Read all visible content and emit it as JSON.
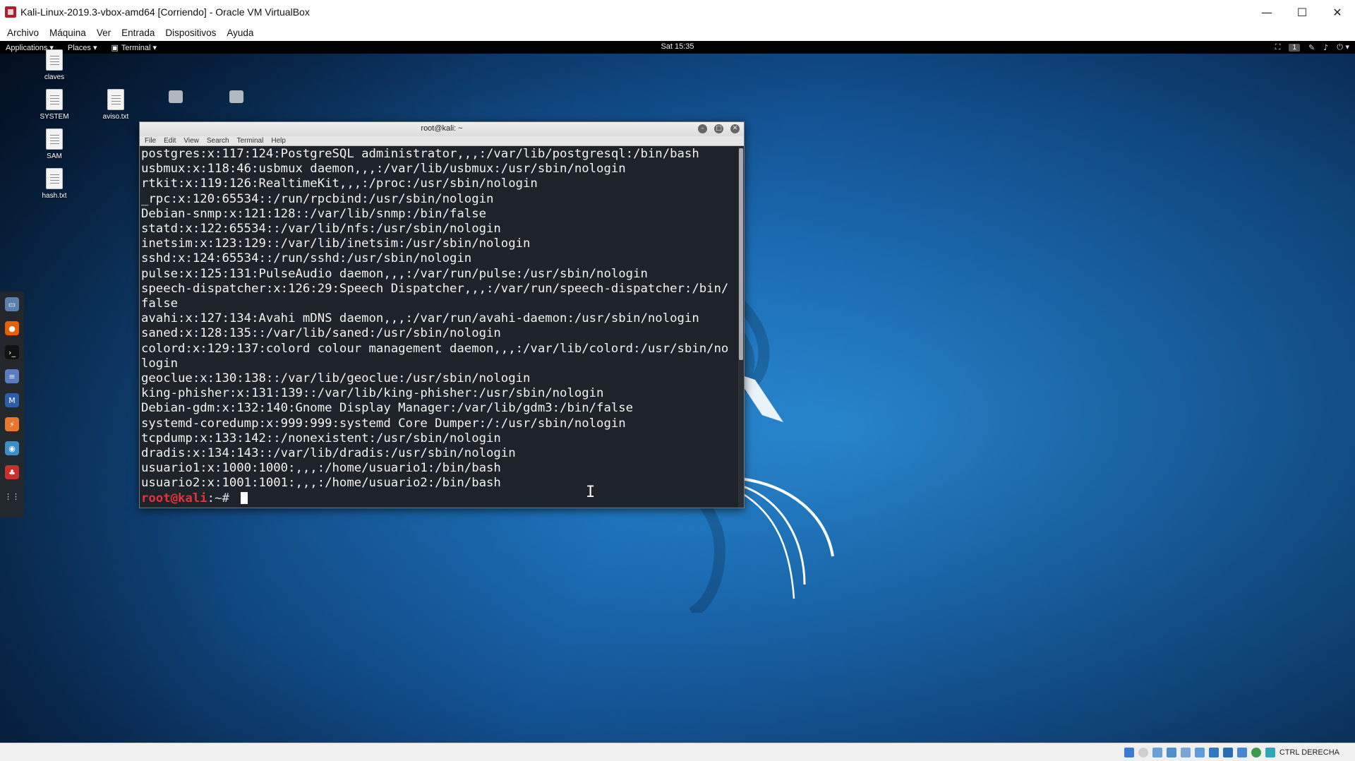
{
  "vbox": {
    "title": "Kali-Linux-2019.3-vbox-amd64 [Corriendo] - Oracle VM VirtualBox",
    "menu": [
      "Archivo",
      "Máquina",
      "Ver",
      "Entrada",
      "Dispositivos",
      "Ayuda"
    ],
    "host_key": "CTRL DERECHA",
    "window_controls": {
      "minimize": "—",
      "maximize": "☐",
      "close": "✕"
    }
  },
  "gnome_panel": {
    "applications": "Applications ▾",
    "places": "Places ▾",
    "terminal": "Terminal ▾",
    "clock": "Sat 15:35",
    "workspace": "1"
  },
  "desktop_icons": [
    {
      "label": "claves",
      "icon": "document-icon"
    },
    {
      "label": "SYSTEM",
      "icon": "document-icon"
    },
    {
      "label": "aviso.txt",
      "icon": "document-icon"
    },
    {
      "label": "SAM",
      "icon": "document-icon"
    },
    {
      "label": "hash.txt",
      "icon": "document-icon"
    }
  ],
  "dock": [
    "files-icon",
    "firefox-icon",
    "terminal-icon",
    "notes-icon",
    "metasploit-icon",
    "burpsuite-icon",
    "eye-icon",
    "armitage-icon",
    "app-grid-icon"
  ],
  "terminal": {
    "title": "root@kali: ~",
    "menu": [
      "File",
      "Edit",
      "View",
      "Search",
      "Terminal",
      "Help"
    ],
    "lines": [
      "postgres:x:117:124:PostgreSQL administrator,,,:/var/lib/postgresql:/bin/bash",
      "usbmux:x:118:46:usbmux daemon,,,:/var/lib/usbmux:/usr/sbin/nologin",
      "rtkit:x:119:126:RealtimeKit,,,:/proc:/usr/sbin/nologin",
      "_rpc:x:120:65534::/run/rpcbind:/usr/sbin/nologin",
      "Debian-snmp:x:121:128::/var/lib/snmp:/bin/false",
      "statd:x:122:65534::/var/lib/nfs:/usr/sbin/nologin",
      "inetsim:x:123:129::/var/lib/inetsim:/usr/sbin/nologin",
      "sshd:x:124:65534::/run/sshd:/usr/sbin/nologin",
      "pulse:x:125:131:PulseAudio daemon,,,:/var/run/pulse:/usr/sbin/nologin",
      "speech-dispatcher:x:126:29:Speech Dispatcher,,,:/var/run/speech-dispatcher:/bin/",
      "false",
      "avahi:x:127:134:Avahi mDNS daemon,,,:/var/run/avahi-daemon:/usr/sbin/nologin",
      "saned:x:128:135::/var/lib/saned:/usr/sbin/nologin",
      "colord:x:129:137:colord colour management daemon,,,:/var/lib/colord:/usr/sbin/no",
      "login",
      "geoclue:x:130:138::/var/lib/geoclue:/usr/sbin/nologin",
      "king-phisher:x:131:139::/var/lib/king-phisher:/usr/sbin/nologin",
      "Debian-gdm:x:132:140:Gnome Display Manager:/var/lib/gdm3:/bin/false",
      "systemd-coredump:x:999:999:systemd Core Dumper:/:/usr/sbin/nologin",
      "tcpdump:x:133:142::/nonexistent:/usr/sbin/nologin",
      "dradis:x:134:143::/var/lib/dradis:/usr/sbin/nologin",
      "usuario1:x:1000:1000:,,,:/home/usuario1:/bin/bash",
      "usuario2:x:1001:1001:,,,:/home/usuario2:/bin/bash"
    ],
    "prompt_user": "root@kali",
    "prompt_sep": ":~# "
  }
}
